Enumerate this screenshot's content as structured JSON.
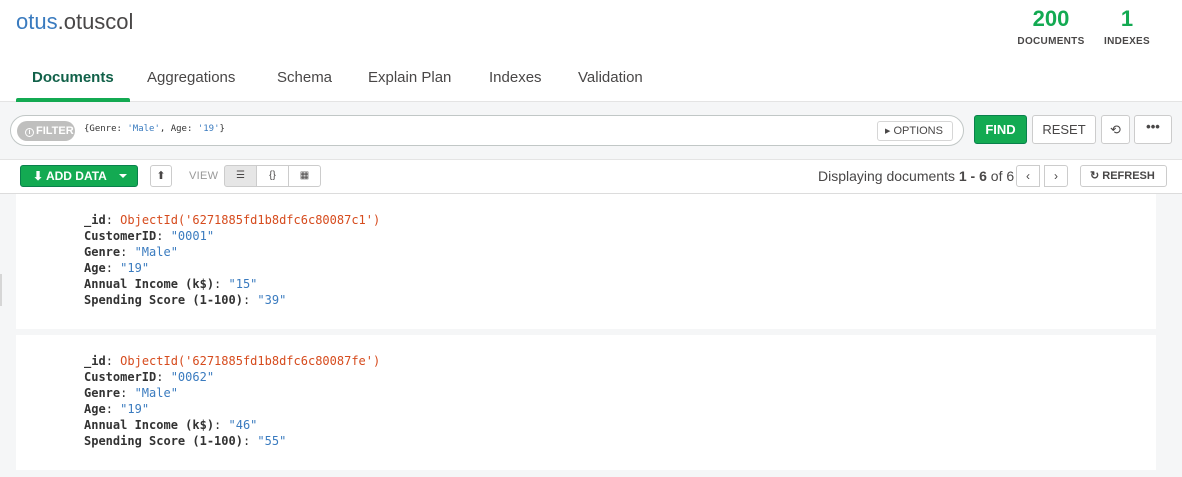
{
  "namespace": {
    "db": "otus",
    "separator": ".",
    "collection": "otuscol"
  },
  "stats": [
    {
      "value": "200",
      "label": "DOCUMENTS"
    },
    {
      "value": "1",
      "label": "INDEXES"
    }
  ],
  "tabs": [
    {
      "label": "Documents",
      "active": true
    },
    {
      "label": "Aggregations"
    },
    {
      "label": "Schema"
    },
    {
      "label": "Explain Plan"
    },
    {
      "label": "Indexes"
    },
    {
      "label": "Validation"
    }
  ],
  "querybar": {
    "filter_label": "FILTER",
    "filter_open": "{Genre: ",
    "filter_val1": "'Male'",
    "filter_mid": ", Age: ",
    "filter_val2": "'19'",
    "filter_close": "}",
    "options_label": "OPTIONS",
    "find_label": "FIND",
    "reset_label": "RESET",
    "more_label": "•••"
  },
  "toolbar": {
    "add_data_label": "ADD DATA",
    "view_label": "VIEW",
    "display_prefix": "Displaying documents ",
    "range_start": "1",
    "range_sep": " - ",
    "range_end": "6",
    "of_text": " of ",
    "total": "6",
    "refresh_label": "REFRESH"
  },
  "documents": [
    {
      "fields": [
        {
          "key": "_id",
          "value": "ObjectId('6271885fd1b8dfc6c80087c1')",
          "type": "oid"
        },
        {
          "key": "CustomerID",
          "value": "\"0001\"",
          "type": "string"
        },
        {
          "key": "Genre",
          "value": "\"Male\"",
          "type": "string"
        },
        {
          "key": "Age",
          "value": "\"19\"",
          "type": "string"
        },
        {
          "key": "Annual Income (k$)",
          "value": "\"15\"",
          "type": "string"
        },
        {
          "key": "Spending Score (1-100)",
          "value": "\"39\"",
          "type": "string"
        }
      ]
    },
    {
      "fields": [
        {
          "key": "_id",
          "value": "ObjectId('6271885fd1b8dfc6c80087fe')",
          "type": "oid"
        },
        {
          "key": "CustomerID",
          "value": "\"0062\"",
          "type": "string"
        },
        {
          "key": "Genre",
          "value": "\"Male\"",
          "type": "string"
        },
        {
          "key": "Age",
          "value": "\"19\"",
          "type": "string"
        },
        {
          "key": "Annual Income (k$)",
          "value": "\"46\"",
          "type": "string"
        },
        {
          "key": "Spending Score (1-100)",
          "value": "\"55\"",
          "type": "string"
        }
      ]
    }
  ],
  "colors": {
    "accent": "#13aa52",
    "link": "#3a7bbf",
    "objectid": "#d64b1d"
  }
}
